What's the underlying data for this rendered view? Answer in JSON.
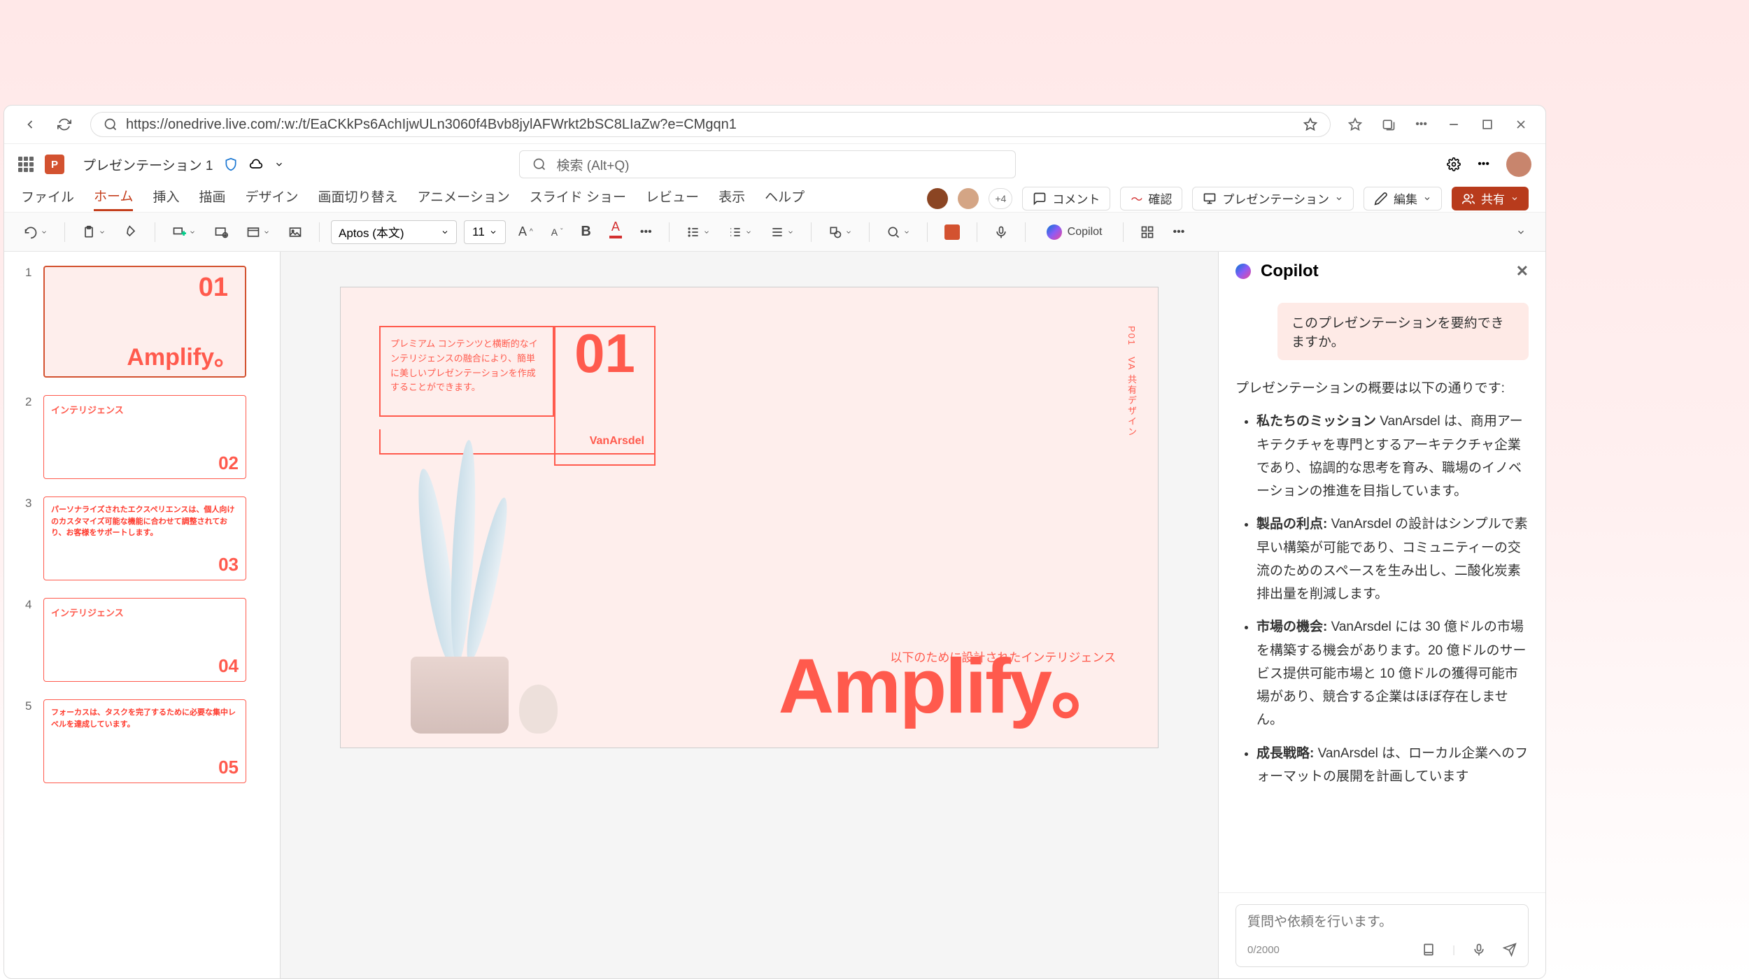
{
  "browser": {
    "url": "https://onedrive.live.com/:w:/t/EaCKkPs6AchIjwULn3060f4Bvb8jylAFWrkt2bSC8LIaZw?e=CMgqn1"
  },
  "app": {
    "doc_title": "プレゼンテーション 1",
    "search_placeholder": "検索 (Alt+Q)"
  },
  "tabs": {
    "file": "ファイル",
    "home": "ホーム",
    "insert": "挿入",
    "draw": "描画",
    "design": "デザイン",
    "transitions": "画面切り替え",
    "animations": "アニメーション",
    "slideshow": "スライド ショー",
    "review": "レビュー",
    "view": "表示",
    "help": "ヘルプ",
    "plus_count": "+4",
    "comment": "コメント",
    "confirm": "確認",
    "presentation": "プレゼンテーション",
    "edit": "編集",
    "share": "共有"
  },
  "ribbon": {
    "font": "Aptos (本文)",
    "size": "11",
    "copilot": "Copilot"
  },
  "thumbs": {
    "t1_num": "01",
    "t1_title": "Amplify。",
    "t2_title": "インテリジェンス",
    "t2_num": "02",
    "t3_title": "パーソナライズされたエクスペリエンスは、個人向けのカスタマイズ可能な機能に合わせて調整されており、お客様をサポートします。",
    "t3_num": "03",
    "t4_title": "インテリジェンス",
    "t4_num": "04",
    "t5_title": "フォーカスは、タスクを完了するために必要な集中レベルを達成しています。",
    "t5_num": "05"
  },
  "slide": {
    "box1": "プレミアム コンテンツと横断的なインテリジェンスの融合により、簡単に美しいプレゼンテーションを作成することができます。",
    "num": "01",
    "brand": "VanArsdel",
    "side": "P01　VA 共有デザイン",
    "tag": "以下のために設計されたインテリジェンス",
    "amp": "Amplify。"
  },
  "copilot": {
    "title": "Copilot",
    "user_prompt": "このプレゼンテーションを要約できますか。",
    "overview": "プレゼンテーションの概要は以下の通りです:",
    "b1_bold": "私たちのミッション",
    "b1_text": " VanArsdel は、商用アーキテクチャを専門とするアーキテクチャ企業であり、協調的な思考を育み、職場のイノベーションの推進を目指しています。",
    "b2_bold": "製品の利点:",
    "b2_text": " VanArsdel の設計はシンプルで素早い構築が可能であり、コミュニティーの交流のためのスペースを生み出し、二酸化炭素排出量を削減します。",
    "b3_bold": "市場の機会:",
    "b3_text": " VanArsdel には 30 億ドルの市場を構築する機会があります。20 億ドルのサービス提供可能市場と 10 億ドルの獲得可能市場があり、競合する企業はほぼ存在しません。",
    "b4_bold": "成長戦略:",
    "b4_text": " VanArsdel は、ローカル企業へのフォーマットの展開を計画しています",
    "input_placeholder": "質問や依頼を行います。",
    "counter": "0/2000"
  }
}
